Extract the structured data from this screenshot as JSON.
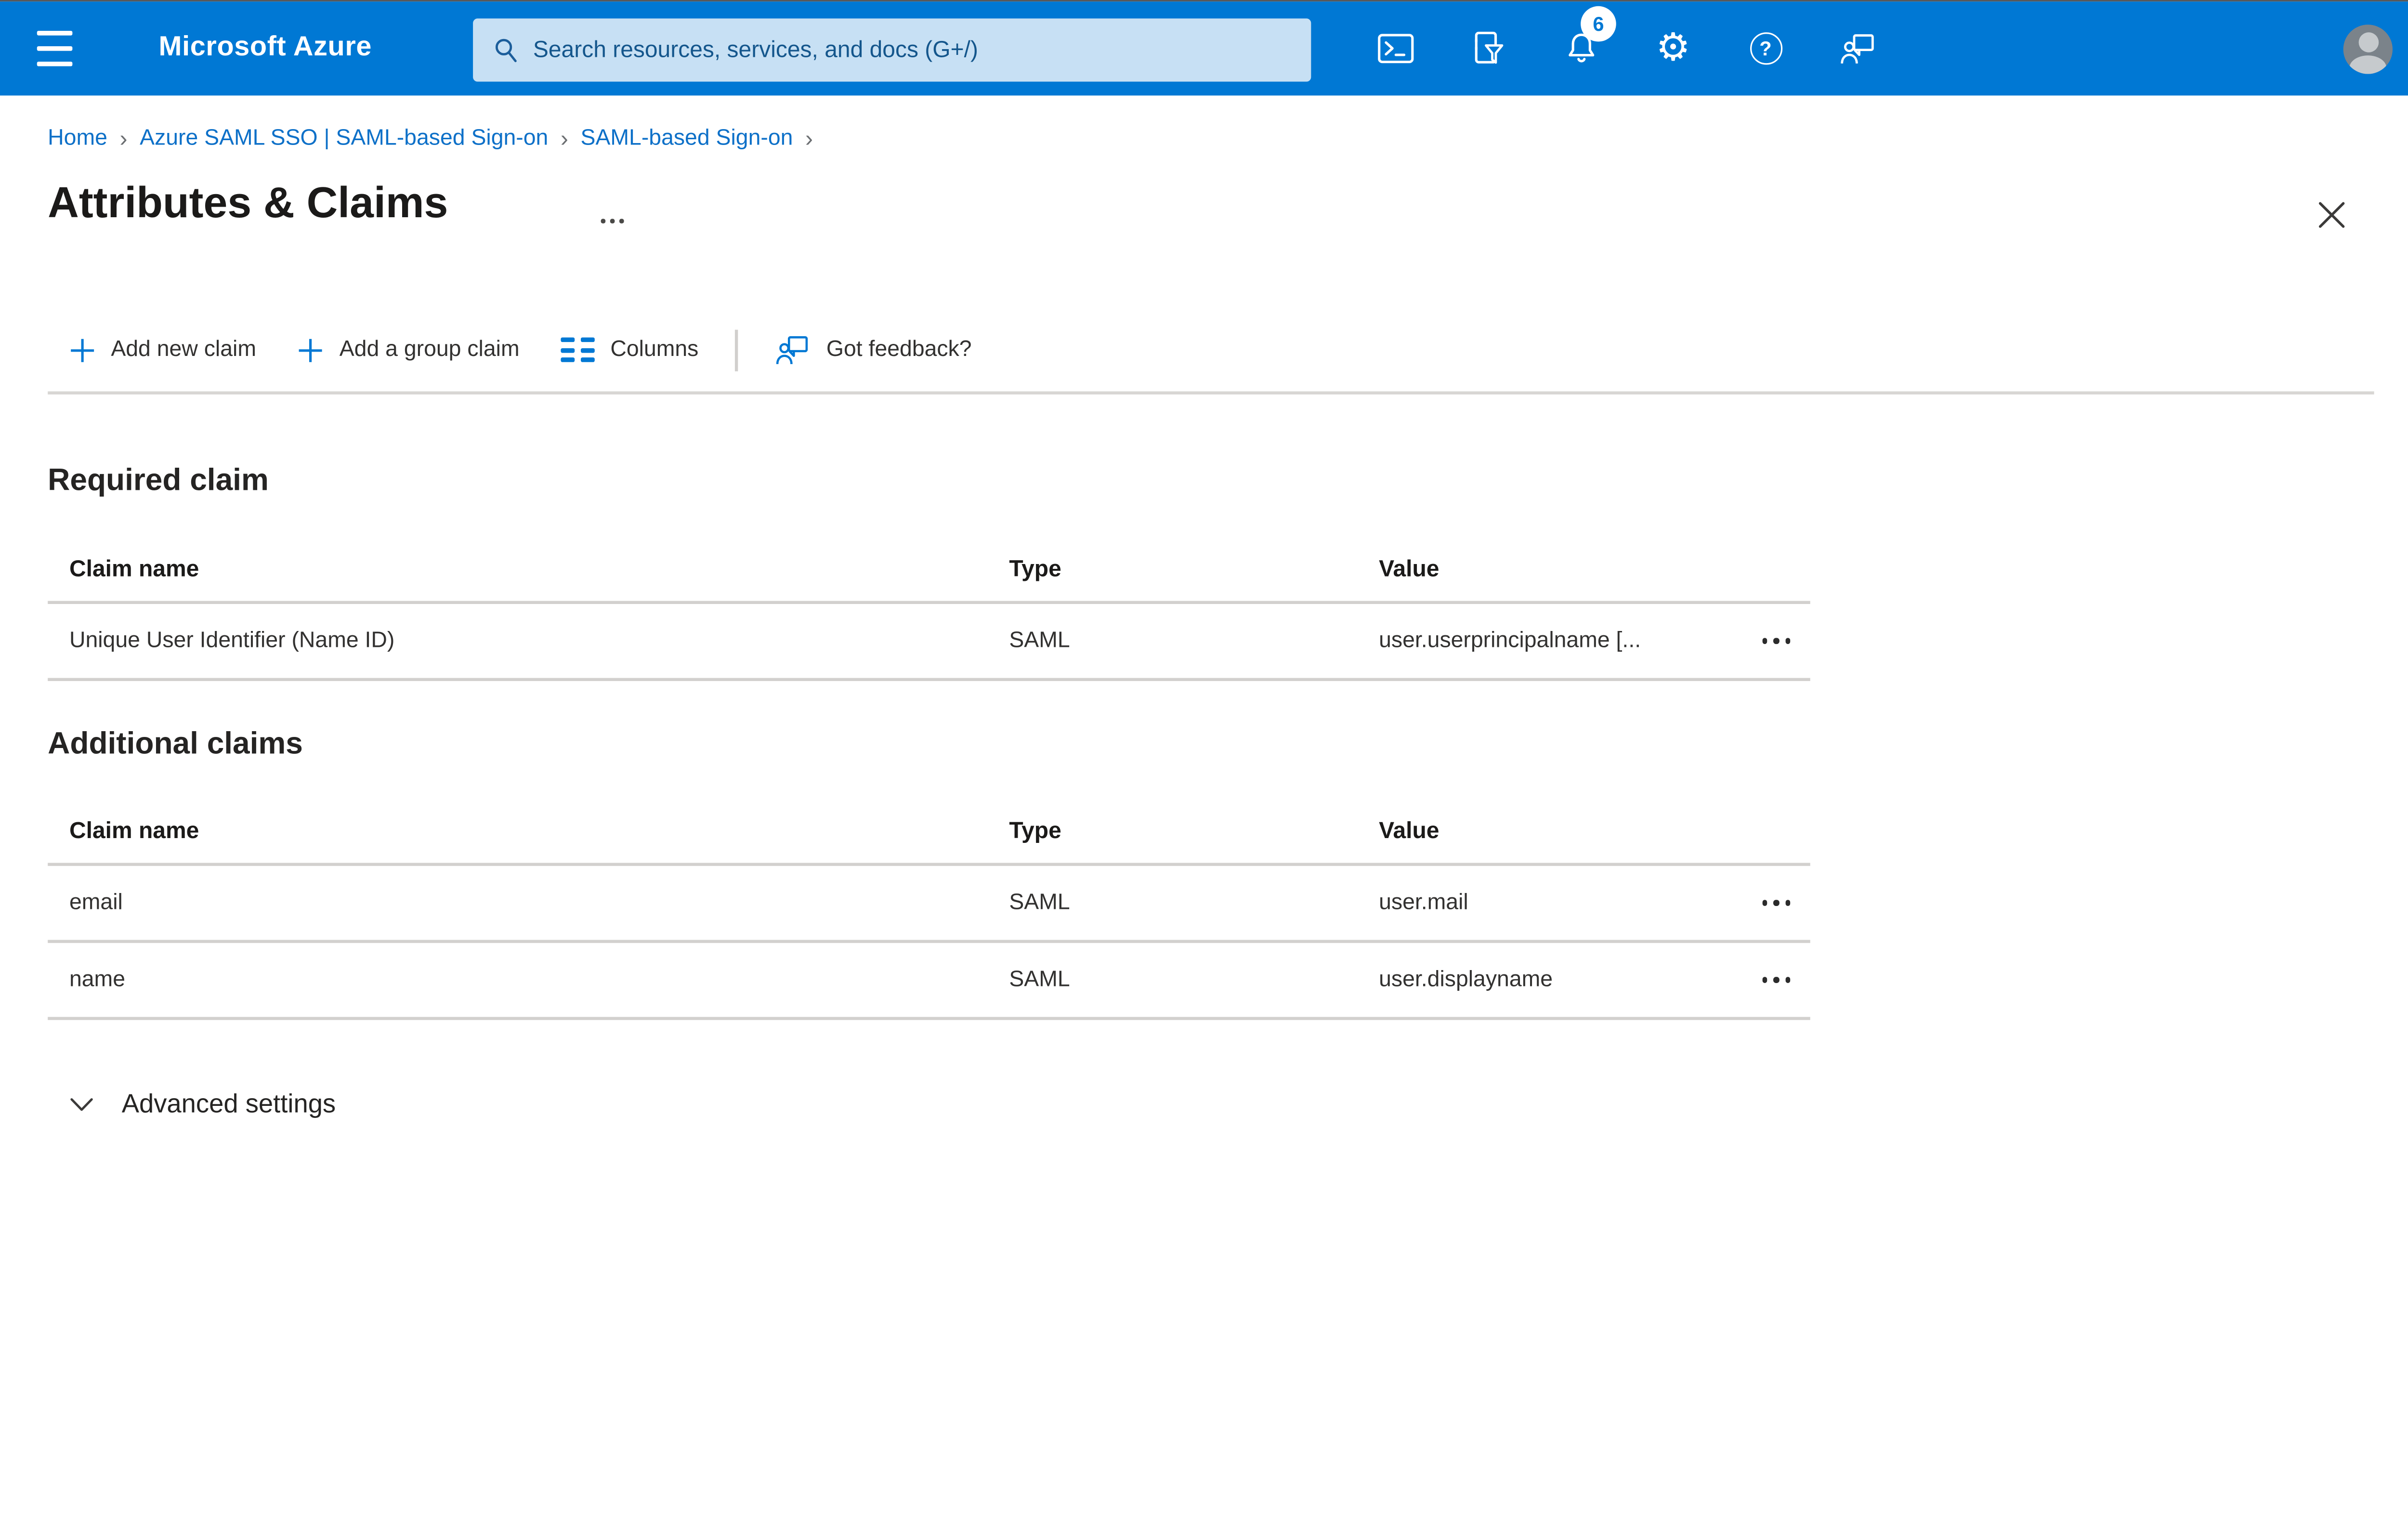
{
  "colors": {
    "topbar_blue": "#0078d4",
    "search_bg": "#c7e0f4",
    "search_text": "#14568c",
    "link_blue": "#0d70c8",
    "accent_blue": "#0078d4",
    "text_dark": "#323130",
    "heading_dark": "#1b1a19",
    "separator_gray": "#d2d0ce",
    "badge_bg": "#ffffff",
    "badge_text": "#0078d4",
    "avatar_gray": "#7b838a"
  },
  "topbar": {
    "brand": "Microsoft Azure",
    "search_placeholder": "Search resources, services, and docs (G+/)",
    "notification_count": "6",
    "icon_names": [
      "cloud-shell-icon",
      "subscription-filter-icon",
      "bell-icon",
      "gear-icon",
      "help-icon",
      "feedback-icon",
      "avatar"
    ]
  },
  "icons": {
    "help_glyph": "?",
    "gear_glyph": "⚙"
  },
  "breadcrumb": {
    "separator": "›",
    "items": [
      {
        "label": "Home"
      },
      {
        "label": "Azure SAML SSO | SAML-based Sign-on"
      },
      {
        "label": "SAML-based Sign-on"
      }
    ]
  },
  "page": {
    "title": "Attributes & Claims"
  },
  "toolbar": {
    "add_new_claim": "Add new claim",
    "add_group_claim": "Add a group claim",
    "columns": "Columns",
    "got_feedback": "Got feedback?"
  },
  "required_claim": {
    "heading": "Required claim",
    "columns": [
      "Claim name",
      "Type",
      "Value"
    ],
    "rows": [
      {
        "claim_name": "Unique User Identifier (Name ID)",
        "type": "SAML",
        "value": "user.userprincipalname [..."
      }
    ]
  },
  "additional_claims": {
    "heading": "Additional claims",
    "columns": [
      "Claim name",
      "Type",
      "Value"
    ],
    "rows": [
      {
        "claim_name": "email",
        "type": "SAML",
        "value": "user.mail"
      },
      {
        "claim_name": "name",
        "type": "SAML",
        "value": "user.displayname"
      }
    ]
  },
  "advanced_settings": {
    "label": "Advanced settings"
  }
}
